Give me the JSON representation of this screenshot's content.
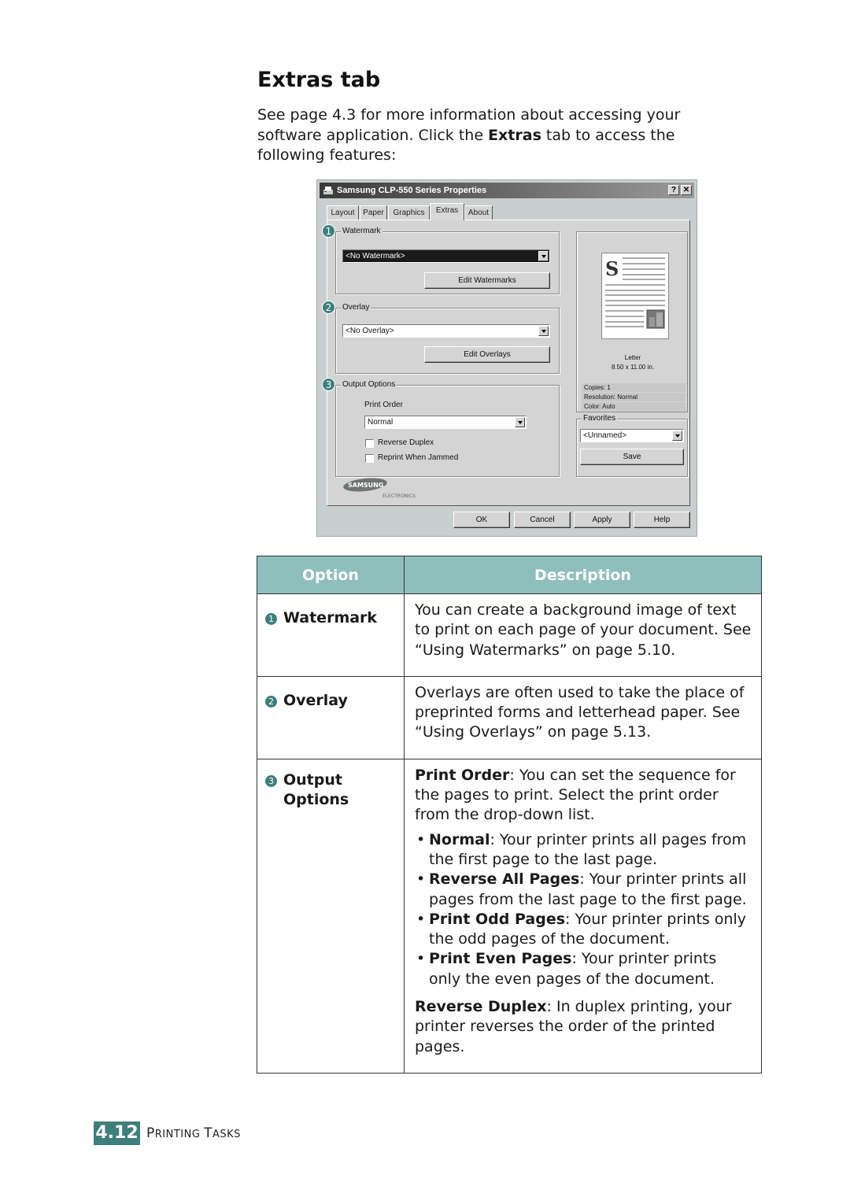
{
  "heading": "Extras tab",
  "intro": {
    "part1": "See page 4.3 for more information about accessing your software application. Click the ",
    "bold": "Extras",
    "part2": " tab to access the following features:"
  },
  "dialog": {
    "title": "Samsung CLP-550 Series Properties",
    "help_btn": "?",
    "close_btn": "✕",
    "tabs": [
      {
        "label": "Layout"
      },
      {
        "label": "Paper"
      },
      {
        "label": "Graphics"
      },
      {
        "label": "Extras",
        "active": true
      },
      {
        "label": "About"
      }
    ],
    "watermark": {
      "number": "1",
      "label": "Watermark",
      "selected": "<No Watermark>",
      "button": "Edit Watermarks"
    },
    "overlay": {
      "number": "2",
      "label": "Overlay",
      "selected": "<No Overlay>",
      "button": "Edit Overlays"
    },
    "output": {
      "number": "3",
      "label": "Output Options",
      "print_order_label": "Print Order",
      "print_order_value": "Normal",
      "reverse_duplex": "Reverse Duplex",
      "reprint": "Reprint When Jammed"
    },
    "preview": {
      "paper": "Letter",
      "size": "8.50 x 11.00 in.",
      "copies": "Copies: 1",
      "resolution": "Resolution: Normal",
      "color": "Color: Auto"
    },
    "favorites": {
      "label": "Favorites",
      "selected": "<Unnamed>",
      "save": "Save"
    },
    "brand": "SAMSUNG",
    "brand_sub": "ELECTRONICS",
    "buttons": {
      "ok": "OK",
      "cancel": "Cancel",
      "apply": "Apply",
      "help": "Help"
    }
  },
  "table": {
    "headers": {
      "option": "Option",
      "description": "Description"
    },
    "rows": [
      {
        "num": "1",
        "option": "Watermark",
        "desc": "You can create a background image of text to print on each page of your document. See “Using Watermarks” on page 5.10."
      },
      {
        "num": "2",
        "option": "Overlay",
        "desc": "Overlays are often used to take the place of preprinted forms and letterhead paper. See “Using Overlays” on page 5.13."
      },
      {
        "num": "3",
        "option": "Output Options",
        "print_order_bold": "Print Order",
        "print_order_text": ": You can set the sequence for the pages to print. Select the print order from the drop-down list.",
        "bullets": [
          {
            "bold": "Normal",
            "text": ": Your printer prints all pages from the first page to the last page."
          },
          {
            "bold": "Reverse All Pages",
            "text": ": Your printer prints all pages from the last page to the first page."
          },
          {
            "bold": "Print Odd Pages",
            "text": ": Your printer prints only the odd pages of the document."
          },
          {
            "bold": "Print Even Pages",
            "text": ": Your printer prints only the even pages of the document."
          }
        ],
        "reverse_duplex_bold": "Reverse Duplex",
        "reverse_duplex_text": ": In duplex printing, your printer reverses the order of the printed pages."
      }
    ]
  },
  "footer": {
    "page_number": "4.12",
    "section_first_p": "P",
    "section_rest_p": "RINTING ",
    "section_first_t": "T",
    "section_rest_t": "ASKS"
  },
  "colors": {
    "accent": "#3e7f7c",
    "table_header": "#8fbfbd"
  }
}
